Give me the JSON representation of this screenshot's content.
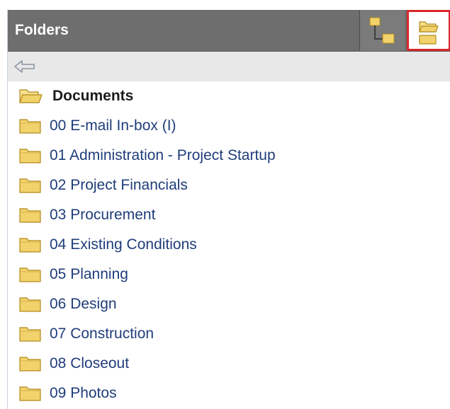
{
  "panel": {
    "title": "Folders"
  },
  "colors": {
    "header_bg": "#6e6e6e",
    "folder_yellow": "#f2d26b",
    "selection_border": "#d9262c",
    "link_text": "#1f3d7a"
  },
  "view_buttons": [
    {
      "icon": "tree-view-icon"
    },
    {
      "icon": "folder-view-icon",
      "selected": true
    }
  ],
  "toolbar": {
    "back_icon": "back-arrow-icon"
  },
  "root": {
    "label": "Documents",
    "icon": "open-folder-icon"
  },
  "folders": [
    {
      "label": "00 E-mail In-box (I)"
    },
    {
      "label": "01 Administration - Project Startup"
    },
    {
      "label": "02 Project Financials"
    },
    {
      "label": "03 Procurement"
    },
    {
      "label": "04 Existing Conditions"
    },
    {
      "label": "05 Planning"
    },
    {
      "label": "06 Design"
    },
    {
      "label": "07 Construction"
    },
    {
      "label": "08 Closeout"
    },
    {
      "label": "09 Photos"
    }
  ]
}
